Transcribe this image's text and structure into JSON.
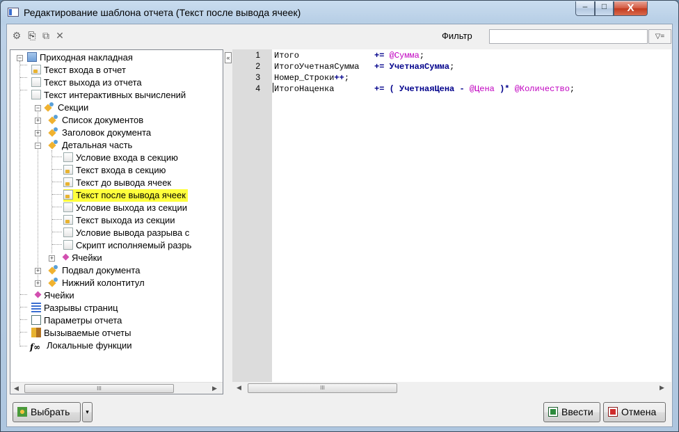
{
  "window": {
    "title": "Редактирование шаблона отчета (Текст после вывода ячеек)",
    "min": "–",
    "max": "□",
    "close": "X"
  },
  "toolbar": {
    "filter_label": "Фильтр",
    "filter_value": "",
    "filter_btn": "▽="
  },
  "tree": {
    "root": "Приходная накладная",
    "entry_text": "Текст входа в отчет",
    "exit_text": "Текст выхода из отчета",
    "interactive_text": "Текст интерактивных вычислений",
    "sections": "Секции",
    "doc_list": "Список документов",
    "doc_header": "Заголовок документа",
    "detail": "Детальная часть",
    "sec_entry_cond": "Условие входа в секцию",
    "sec_entry_text": "Текст входа в секцию",
    "before_cells": "Текст до вывода ячеек",
    "after_cells": "Текст после вывода ячеек",
    "sec_exit_cond": "Условие выхода из секции",
    "sec_exit_text": "Текст выхода из секции",
    "break_cond": "Условие вывода разрыва с",
    "break_script": "Скрипт исполняемый разрь",
    "cells_sub": "Ячейки",
    "doc_footer": "Подвал документа",
    "page_footer": "Нижний колонтитул",
    "cells": "Ячейки",
    "page_breaks": "Разрывы страниц",
    "report_params": "Параметры отчета",
    "called_reports": "Вызываемые отчеты",
    "local_funcs": "Локальные функции",
    "fx": "f∞"
  },
  "editor": {
    "line_numbers": [
      "1",
      "2",
      "3",
      "4"
    ],
    "lines": [
      {
        "a": "Итого",
        "pad": "               ",
        "op": "+=",
        "sp": " ",
        "v": "@Сумма",
        "end": ";"
      },
      {
        "a": "ИтогоУчетнаяСумма",
        "pad": "   ",
        "op": "+=",
        "sp": " ",
        "v": "УчетнаяСумма",
        "end": ";"
      },
      {
        "a": "Номер_Строки",
        "op": "++",
        "end": ";"
      },
      {
        "a": "ИтогоНаценка",
        "pad": "        ",
        "op": "+=",
        "rest1": " ( ",
        "b": "УчетнаяЦена",
        "mid": " - ",
        "v1": "@Цена",
        "rest2": " )* ",
        "v2": "@Количество",
        "end": ";"
      }
    ]
  },
  "scroll": {
    "thumb": "III",
    "left": "◀",
    "right": "▶"
  },
  "buttons": {
    "select": "Выбрать",
    "dropdown": "▾",
    "ok": "Ввести",
    "cancel": "Отмена",
    "collapse": "«"
  },
  "colors": {
    "keyword_op": "#00008b",
    "variable": "#c000c0",
    "selection": "#ffff3c"
  }
}
